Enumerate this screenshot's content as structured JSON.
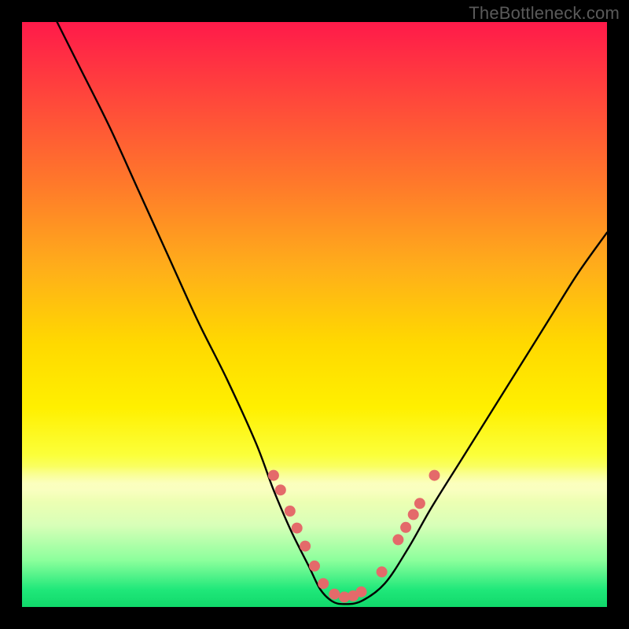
{
  "watermark": "TheBottleneck.com",
  "chart_data": {
    "type": "line",
    "title": "",
    "xlabel": "",
    "ylabel": "",
    "xlim": [
      0,
      100
    ],
    "ylim": [
      0,
      100
    ],
    "series": [
      {
        "name": "bottleneck-curve",
        "x": [
          6,
          10,
          15,
          20,
          25,
          30,
          35,
          40,
          43,
          46,
          49,
          51,
          53,
          55,
          58,
          62,
          66,
          70,
          75,
          80,
          85,
          90,
          95,
          100
        ],
        "y": [
          100,
          92,
          82,
          71,
          60,
          49,
          39,
          28,
          20,
          13,
          7,
          3,
          1,
          0.5,
          1,
          4,
          10,
          17,
          25,
          33,
          41,
          49,
          57,
          64
        ]
      }
    ],
    "markers": {
      "name": "highlight-dots",
      "x_percent": [
        43.0,
        44.2,
        45.8,
        47.0,
        48.4,
        50.0,
        51.5,
        53.4,
        55.1,
        56.6,
        58.0,
        61.5,
        64.3,
        65.6,
        66.9,
        68.0,
        70.5
      ],
      "y_percent_from_top": [
        77.5,
        80.0,
        83.6,
        86.5,
        89.6,
        93.0,
        96.0,
        97.8,
        98.3,
        98.1,
        97.4,
        94.0,
        88.5,
        86.4,
        84.2,
        82.3,
        77.5
      ],
      "color": "#e46a6a",
      "radius_px": 7
    },
    "background_gradient": {
      "top": "#ff1a4a",
      "mid": "#ffd900",
      "bottom": "#10d86a"
    }
  }
}
